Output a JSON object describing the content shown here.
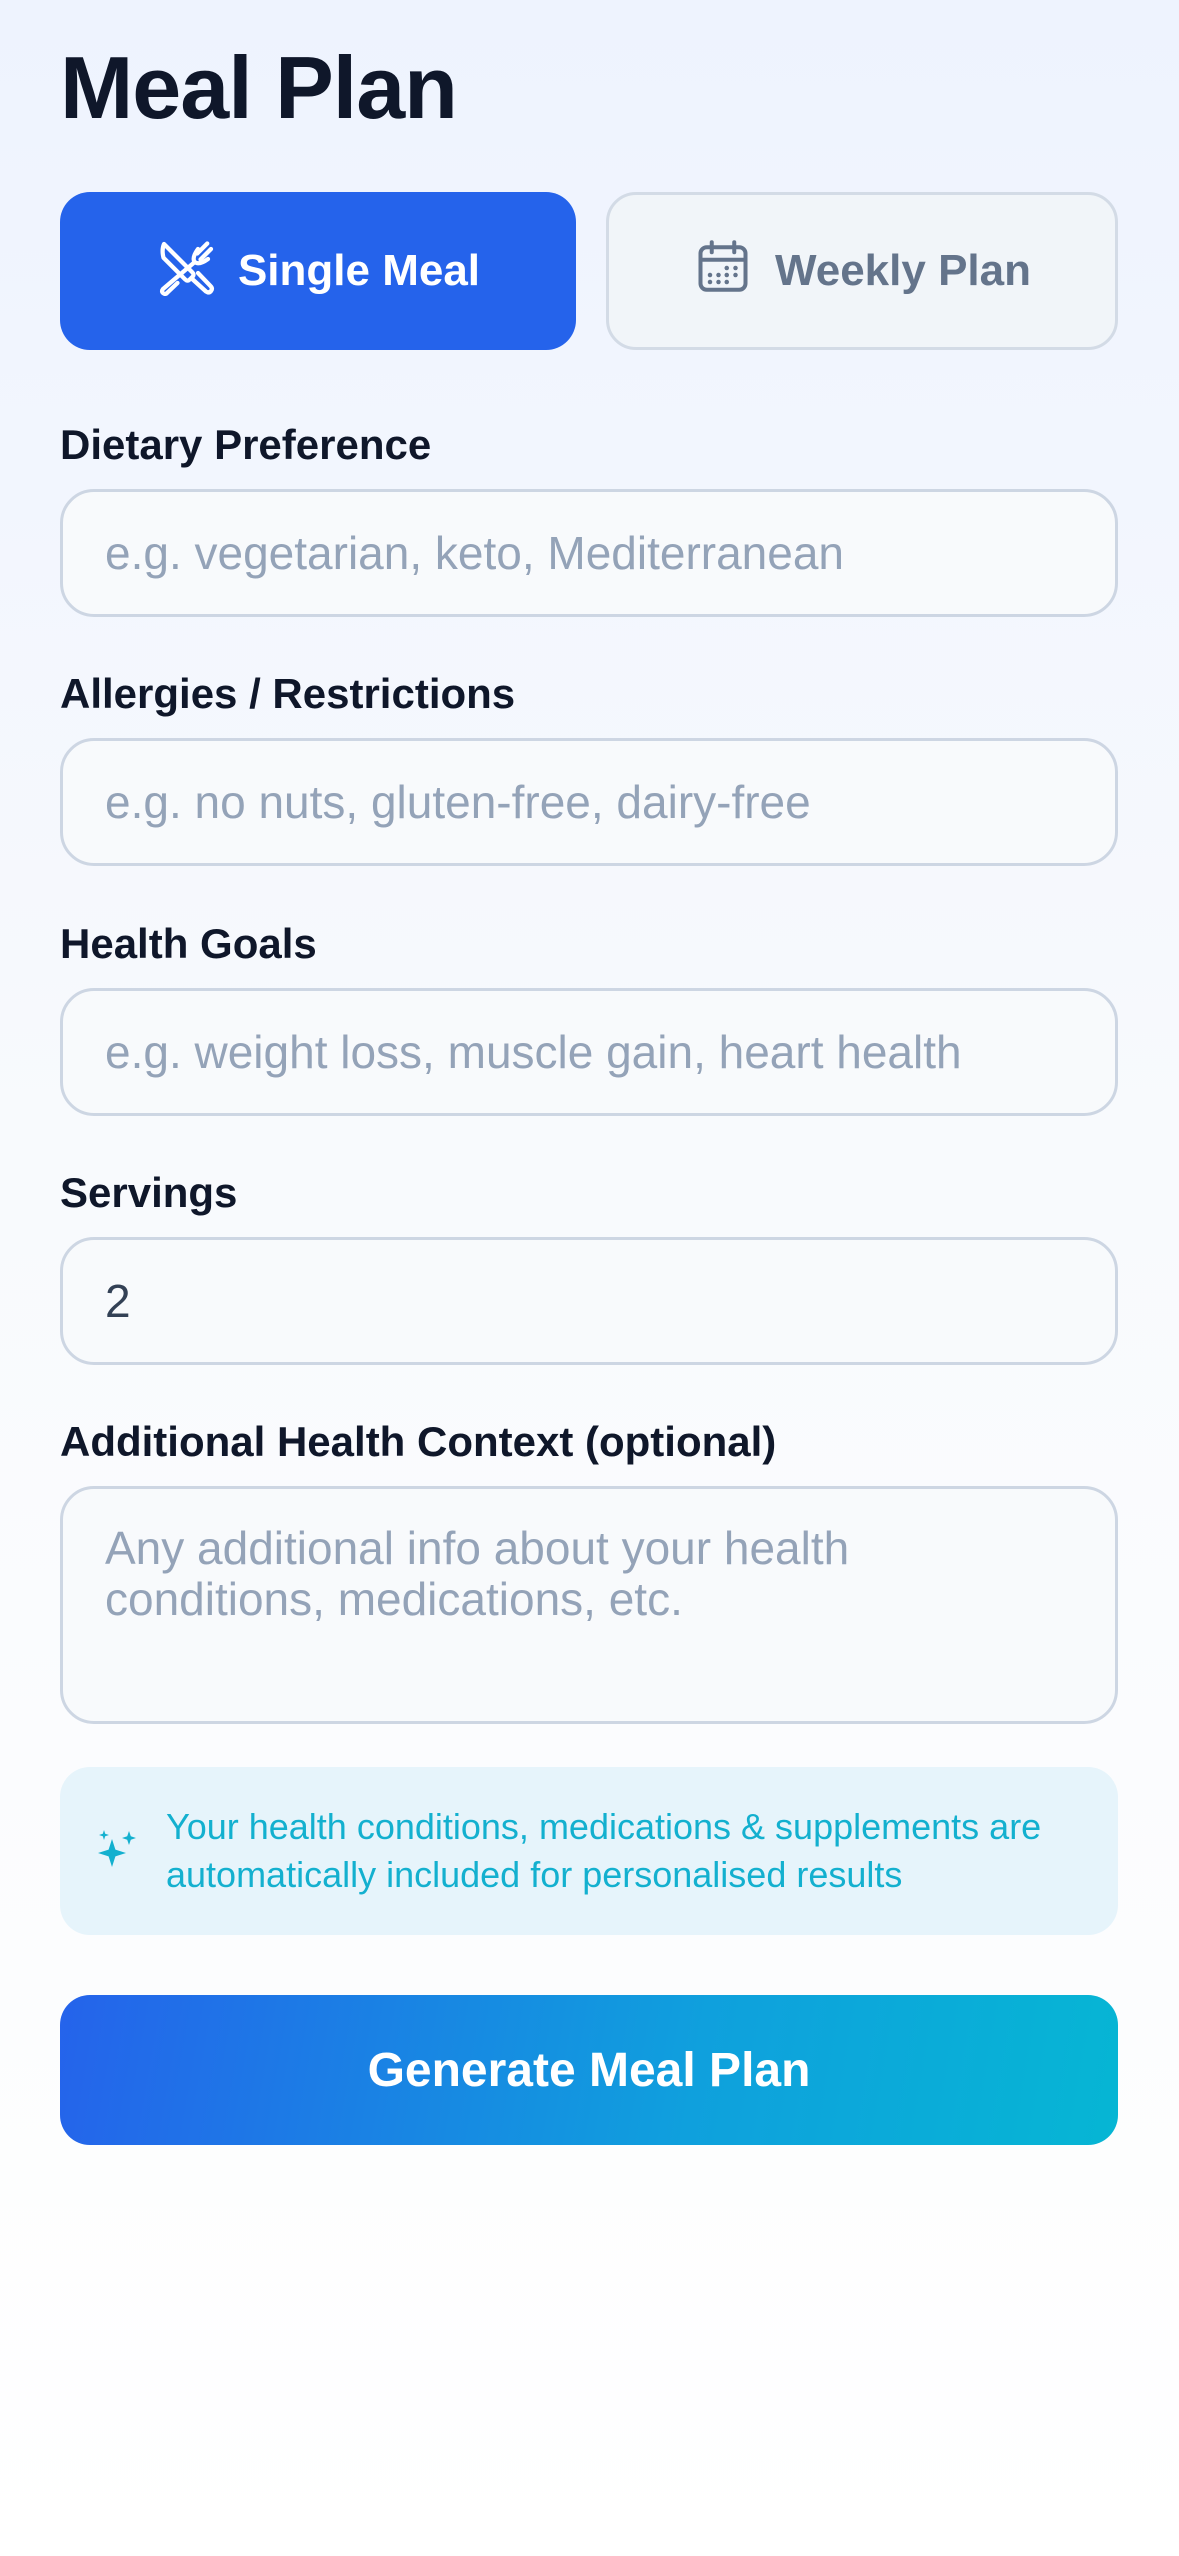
{
  "page": {
    "title": "Meal Plan"
  },
  "mode_toggle": {
    "single": {
      "label": "Single Meal",
      "icon": "utensils-icon",
      "active": true
    },
    "weekly": {
      "label": "Weekly Plan",
      "icon": "calendar-icon",
      "active": false
    }
  },
  "form": {
    "dietary": {
      "label": "Dietary Preference",
      "value": "",
      "placeholder": "e.g. vegetarian, keto, Mediterranean"
    },
    "allergies": {
      "label": "Allergies / Restrictions",
      "value": "",
      "placeholder": "e.g. no nuts, gluten-free, dairy-free"
    },
    "goals": {
      "label": "Health Goals",
      "value": "",
      "placeholder": "e.g. weight loss, muscle gain, heart health"
    },
    "servings": {
      "label": "Servings",
      "value": "2",
      "placeholder": ""
    },
    "context": {
      "label": "Additional Health Context (optional)",
      "value": "",
      "placeholder": "Any additional info about your health conditions, medications, etc."
    }
  },
  "info": {
    "icon": "sparkles-icon",
    "text": "Your health conditions, medications & supplements are automatically included for personalised results"
  },
  "actions": {
    "generate_label": "Generate Meal Plan"
  },
  "colors": {
    "primary": "#2563eb",
    "accent": "#06b6d4",
    "info_text": "#13b0cf",
    "info_bg": "#e6f4fb"
  }
}
